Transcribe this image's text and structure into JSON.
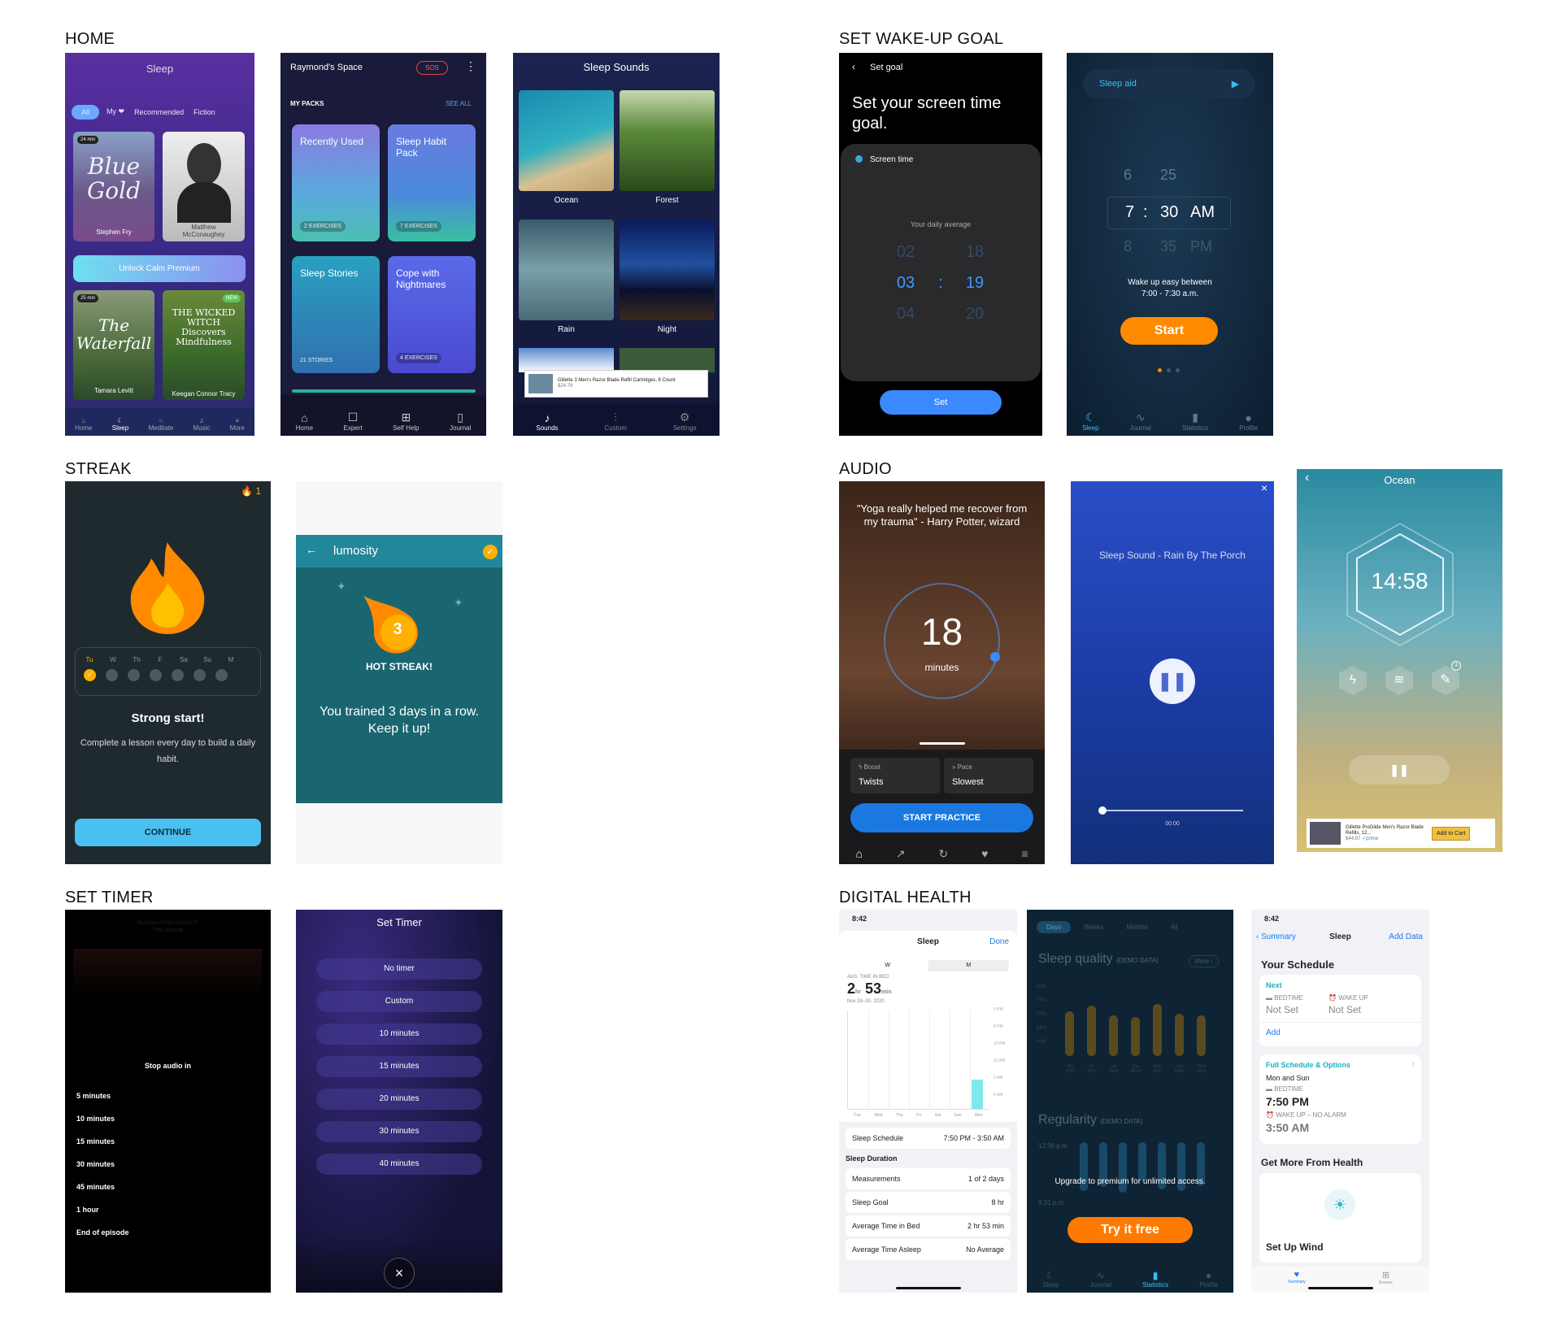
{
  "sections": {
    "home": "HOME",
    "wake": "SET WAKE-UP GOAL",
    "streak": "STREAK",
    "audio": "AUDIO",
    "timer": "SET TIMER",
    "health": "DIGITAL HEALTH"
  },
  "calm": {
    "title": "Sleep",
    "filters": [
      "All",
      "My ❤",
      "Recommended",
      "Fiction"
    ],
    "card1_time": "24 min",
    "card1_title": "Blue Gold",
    "card1_author": "Stephen Fry",
    "card2_author": "Matthew McConaughey",
    "unlock": "Unlock Calm Premium",
    "card3_time": "25 min",
    "card3_title": "The Waterfall",
    "card3_author": "Tamara Levitt",
    "card4_badge": "NEW",
    "card4_title": "THE WICKED WITCH Discovers Mindfulness",
    "card4_author": "Keegan Connor Tracy",
    "nav": [
      "Home",
      "Sleep",
      "Meditate",
      "Music",
      "More"
    ]
  },
  "packs": {
    "space": "Raymond's Space",
    "sos": "SOS",
    "my_packs": "MY PACKS",
    "see_all": "SEE ALL",
    "cards": [
      {
        "title": "Recently Used",
        "count": "2 EXERCISES"
      },
      {
        "title": "Sleep Habit Pack",
        "count": "7 EXERCISES"
      },
      {
        "title": "Sleep Stories",
        "count": "21 STORIES"
      },
      {
        "title": "Cope with Nightmares",
        "count": "4 EXERCISES"
      }
    ],
    "nav": [
      "Home",
      "Expert",
      "Self Help",
      "Journal"
    ]
  },
  "sounds": {
    "title": "Sleep Sounds",
    "items": [
      "Ocean",
      "Forest",
      "Rain",
      "Night"
    ],
    "ad": "Gillette 3 Men's Razor Blade Refill Cartridges, 8 Count",
    "ad_price": "$24.79",
    "nav": [
      "Sounds",
      "Custom",
      "Settings"
    ]
  },
  "goal": {
    "back": "Set goal",
    "heading": "Set your screen time goal.",
    "screen_time": "Screen time",
    "avg": "Your daily average",
    "hours": [
      "02",
      "03",
      "04"
    ],
    "mins": [
      "18",
      "19",
      "20"
    ],
    "sep": ":",
    "button": "Set"
  },
  "alarm": {
    "sleep_aid": "Sleep aid",
    "rows": [
      [
        "6",
        "25",
        ""
      ],
      [
        "7",
        ":",
        "30",
        "AM"
      ],
      [
        "8",
        "35",
        "PM"
      ]
    ],
    "wake": "Wake up easy between",
    "range": "7:00 - 7:30 a.m.",
    "start": "Start",
    "nav": [
      "Sleep",
      "Journal",
      "Statistics",
      "Profile"
    ]
  },
  "streak1": {
    "count": "1",
    "days": [
      "Tu",
      "W",
      "Th",
      "F",
      "Sa",
      "Su",
      "M"
    ],
    "title": "Strong start!",
    "body": "Complete a lesson every day to build a daily habit.",
    "button": "CONTINUE"
  },
  "streak2": {
    "app": "lumosity",
    "num": "3",
    "hot": "HOT STREAK!",
    "body": "You trained 3 days in a row. Keep it up!"
  },
  "yoga": {
    "quote": "\"Yoga really helped me recover from my trauma\" - Harry Potter, wizard",
    "num": "18",
    "unit": "minutes",
    "boost_label": "Boost",
    "boost": "Twists",
    "pace_label": "Pace",
    "pace": "Slowest",
    "button": "START PRACTICE"
  },
  "rain": {
    "title": "Sleep Sound - Rain By The Porch",
    "time": "00:00"
  },
  "ocean": {
    "title": "Ocean",
    "time": "14:58",
    "ad": "Gillette ProGlide Men's Razor Blade Refills, 12...",
    "price": "$44.97",
    "prime": "✓prime",
    "cart": "Add to Cart",
    "badge": "3"
  },
  "stop": {
    "podcast": "PLAYING FROM PODCAST",
    "show": "The Journal",
    "title": "Stop audio in",
    "items": [
      "5 minutes",
      "10 minutes",
      "15 minutes",
      "30 minutes",
      "45 minutes",
      "1 hour",
      "End of episode"
    ]
  },
  "settimer": {
    "title": "Set Timer",
    "items": [
      "No timer",
      "Custom",
      "10 minutes",
      "15 minutes",
      "20 minutes",
      "30 minutes",
      "40 minutes"
    ]
  },
  "apple": {
    "time": "8:42",
    "title": "Sleep",
    "done": "Done",
    "seg": [
      "W",
      "M"
    ],
    "avg_label": "AVG. TIME IN BED",
    "hr": "2",
    "hr_u": "hr",
    "min": "53",
    "min_u": "min",
    "range": "Nov 24–30, 2020",
    "yticks": [
      "6 PM",
      "8 PM",
      "10 PM",
      "12 AM",
      "2 AM",
      "4 AM"
    ],
    "days": [
      "Tue",
      "Wed",
      "Thu",
      "Fri",
      "Sat",
      "Sun",
      "Mon"
    ],
    "schedule_label": "Sleep Schedule",
    "schedule": "7:50 PM - 3:50 AM",
    "duration": "Sleep Duration",
    "rows": [
      [
        "Measurements",
        "1 of 2 days"
      ],
      [
        "Sleep Goal",
        "8 hr"
      ],
      [
        "Average Time in Bed",
        "2 hr 53 min"
      ],
      [
        "Average Time Asleep",
        "No Average"
      ]
    ]
  },
  "quality": {
    "tabs": [
      "Days",
      "Weeks",
      "Months",
      "All"
    ],
    "title": "Sleep quality",
    "demo": "(DEMO DATA)",
    "more": "More ›",
    "yt": [
      "80%",
      "75%",
      "70%",
      "65%",
      "60%"
    ],
    "days": [
      "Thu\n17/12",
      "Fri\n18/12",
      "Sat\n19/12",
      "Sun\n20/12",
      "Mon\n21/12",
      "Tue\n22/12",
      "Wed\n23/12"
    ],
    "reg": "Regularity",
    "reg_demo": "(DEMO DATA)",
    "t1": "12:36 p.m.",
    "t2": "9:31 p.m.",
    "upgrade": "Upgrade to premium for unlimited access.",
    "try": "Try it free",
    "nav": [
      "Sleep",
      "Journal",
      "Statistics",
      "Profile"
    ],
    "bar_heights": [
      0.55,
      0.62,
      0.5,
      0.48,
      0.64,
      0.52,
      0.5
    ]
  },
  "schedule": {
    "time": "8:42",
    "back": "Summary",
    "title": "Sleep",
    "add": "Add Data",
    "your": "Your Schedule",
    "next": "Next",
    "bed_l": "BEDTIME",
    "bed": "Not Set",
    "wake_l": "WAKE UP",
    "wake": "Not Set",
    "add2": "Add",
    "full": "Full Schedule & Options",
    "days": "Mon and Sun",
    "bed2_l": "BEDTIME",
    "bed2": "7:50 PM",
    "wake2_l": "WAKE UP – NO ALARM",
    "wake2": "3:50 AM",
    "more": "Get More From Health",
    "wind": "Set Up Wind",
    "tabs": [
      "Summary",
      "Browse"
    ]
  }
}
